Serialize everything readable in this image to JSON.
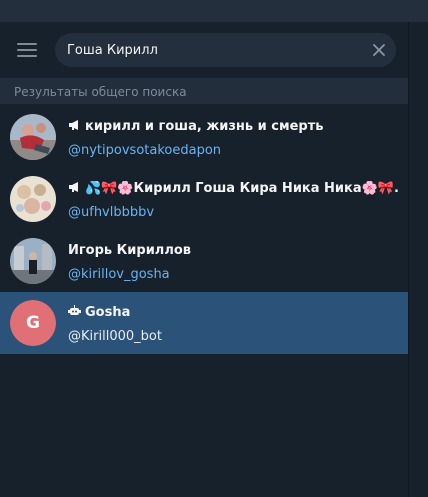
{
  "search": {
    "query": "Гоша Кирилл"
  },
  "section_title": "Результаты общего поиска",
  "results": [
    {
      "name": "кирилл и гоша, жизнь и смерть",
      "username": "@nytipovsotakoedapon",
      "icon": "megaphone-icon"
    },
    {
      "name": "💦🎀🌸Кирилл Гоша Кира Ника Ника🌸🎀...",
      "username": "@ufhvlbbbbv",
      "icon": "megaphone-icon"
    },
    {
      "name": "Игорь Кириллов",
      "username": "@kirillov_gosha",
      "icon": ""
    },
    {
      "name": "Gosha",
      "username": "@Kirill000_bot",
      "icon": "bot-icon",
      "avatar_letter": "G"
    }
  ],
  "colors": {
    "background": "#17212b",
    "selected_row": "#2b5278",
    "username_link": "#6ab3f3",
    "avatar_letter_bg": "#e17076"
  }
}
